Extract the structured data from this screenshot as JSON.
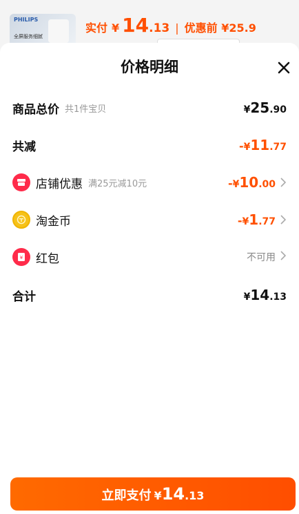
{
  "background": {
    "thumb_brand": "PHILIPS",
    "thumb_desc": "全屏服务细腻",
    "actual_label": "实付",
    "actual_yen": "¥",
    "actual_int": "14",
    "actual_dec": ".13",
    "separator": "|",
    "orig_label": "优惠前 ¥25.9"
  },
  "sheet": {
    "title": "价格明细",
    "close_icon": "close-icon"
  },
  "rows": {
    "total": {
      "label": "商品总价",
      "sub": "共1件宝贝",
      "yen": "¥",
      "int": "25",
      "dec": ".90"
    },
    "reduce": {
      "label": "共减",
      "sign": "-",
      "yen": "¥",
      "int": "11",
      "dec": ".77"
    },
    "shop": {
      "label": "店铺优惠",
      "sub": "满25元减10元",
      "sign": "-",
      "yen": "¥",
      "int": "10",
      "dec": ".00",
      "icon": "shop-icon"
    },
    "coin": {
      "label": "淘金币",
      "sign": "-",
      "yen": "¥",
      "int": "1",
      "dec": ".77",
      "icon": "coin-icon"
    },
    "redpacket": {
      "label": "红包",
      "value": "不可用",
      "icon": "red-packet-icon"
    },
    "sum": {
      "label": "合计",
      "yen": "¥",
      "int": "14",
      "dec": ".13"
    }
  },
  "pay_button": {
    "label": "立即支付",
    "yen": "¥",
    "int": "14",
    "dec": ".13"
  },
  "colors": {
    "accent": "#ff5000",
    "pay_gradient_start": "#ff6a00",
    "pay_gradient_end": "#ff4e00",
    "icon_red": "#ff2b4a",
    "coin_gold": "#f6c21a"
  }
}
